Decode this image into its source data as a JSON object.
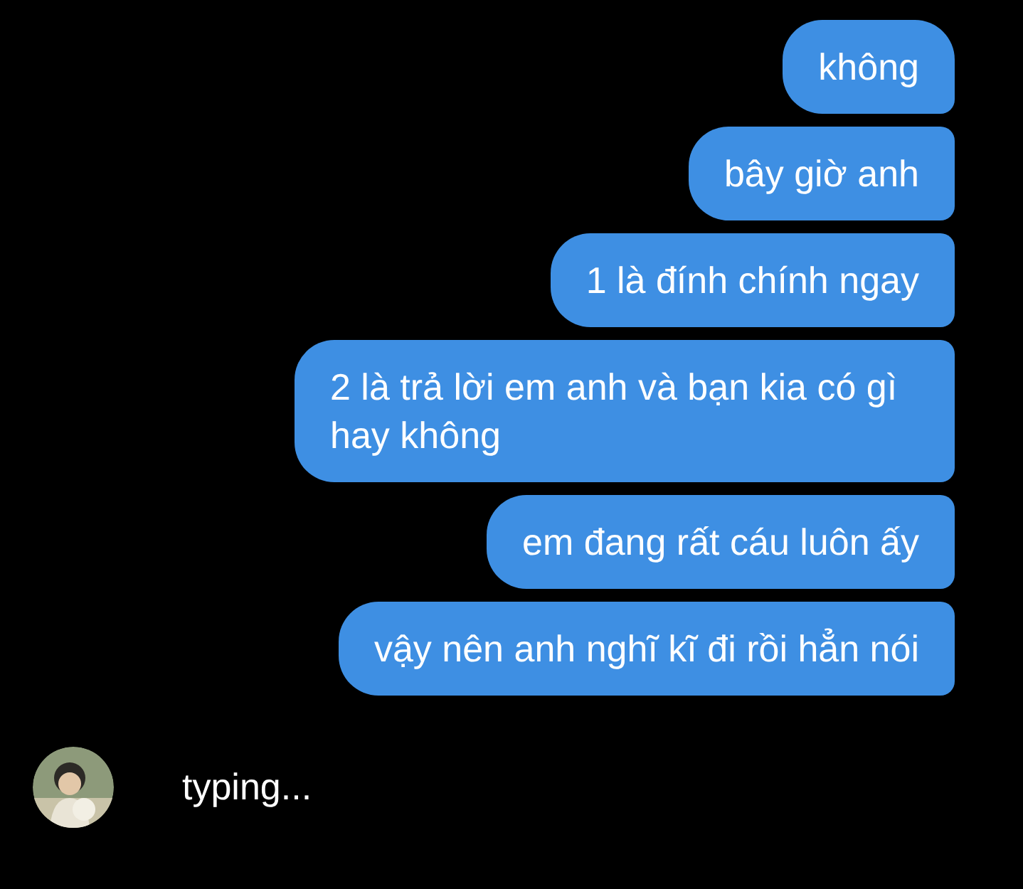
{
  "messages": [
    {
      "text": "không"
    },
    {
      "text": "bây giờ anh"
    },
    {
      "text": "1 là đính chính ngay"
    },
    {
      "text": "2 là trả lời em anh và bạn kia có gì hay không"
    },
    {
      "text": "em đang rất cáu luôn ấy"
    },
    {
      "text": "vậy nên anh nghĩ kĩ đi rồi hẳn nói"
    }
  ],
  "typing": {
    "text": "typing..."
  }
}
